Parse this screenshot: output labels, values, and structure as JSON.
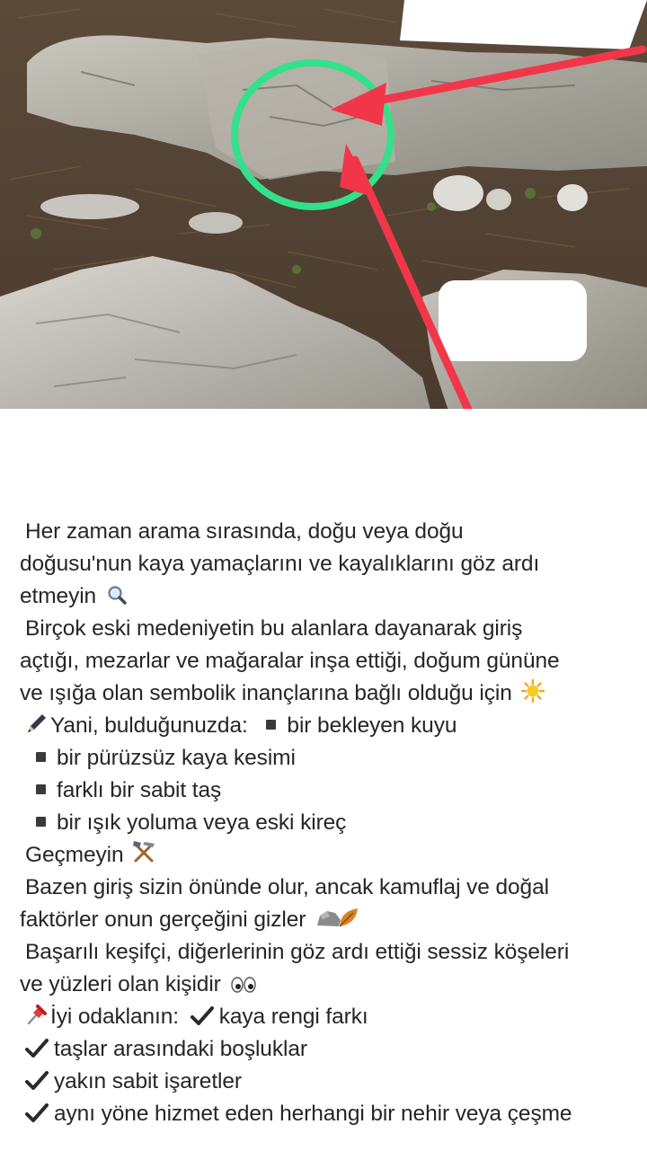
{
  "post": {
    "lines": [
      "Her zaman arama sırasında, doğu veya doğu",
      "doğusu'nun kaya yamaçlarını ve kayalıklarını göz ardı",
      "etmeyin",
      "Birçok eski medeniyetin bu alanlara dayanarak giriş",
      "açtığı, mezarlar ve mağaralar inşa ettiği, doğum gününe",
      "ve ışığa olan sembolik inançlarına bağlı olduğu için",
      "Yani, bulduğunuzda:",
      "bir bekleyen kuyu",
      "bir pürüzsüz kaya kesimi",
      "farklı bir sabit taş",
      "bir ışık yoluma veya eski kireç",
      "Geçmeyin",
      "Bazen giriş sizin önünde olur, ancak kamuflaj ve doğal",
      "faktörler onun gerçeğini gizler",
      "Başarılı keşifçi, diğerlerinin göz ardı ettiği sessiz köşeleri",
      "ve yüzleri olan kişidir",
      "İyi odaklanın:",
      "kaya rengi farkı",
      "taşlar arasındaki boşluklar",
      "yakın sabit işaretler",
      "aynı yöne hizmet eden herhangi bir nehir veya çeşme"
    ],
    "icons": {
      "magnifier": "magnifying-glass-icon",
      "sun": "sun-icon",
      "pen": "pen-icon",
      "tools": "hammer-pick-icon",
      "rock": "rock-icon",
      "leaf": "leaf-icon",
      "eyes": "eyes-icon",
      "pin": "pushpin-icon",
      "check": "check-mark-icon",
      "bullet": "black-square-bullet-icon"
    },
    "colors": {
      "text": "#262626",
      "circle_marker": "#35e08a",
      "arrow_marker": "#f2364a"
    }
  }
}
